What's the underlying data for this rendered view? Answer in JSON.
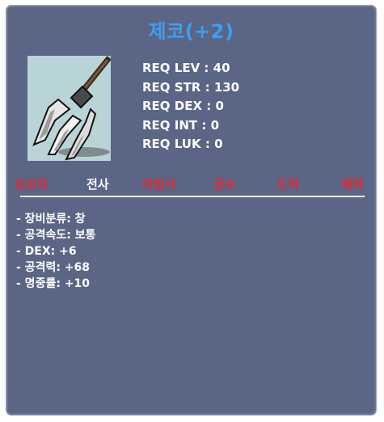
{
  "item": {
    "name": "제코(+2)",
    "icon": "spear-trident-icon",
    "title_color": "#3f9ef2"
  },
  "requirements": [
    {
      "label": "REQ LEV",
      "value": "40"
    },
    {
      "label": "REQ STR",
      "value": "130"
    },
    {
      "label": "REQ DEX",
      "value": "0"
    },
    {
      "label": "REQ INT",
      "value": "0"
    },
    {
      "label": "REQ LUK",
      "value": "0"
    }
  ],
  "jobs": [
    {
      "name": "초보자",
      "color": "#e8282f"
    },
    {
      "name": "전사",
      "color": "#ffffff"
    },
    {
      "name": "마법사",
      "color": "#e8282f"
    },
    {
      "name": "궁수",
      "color": "#e8282f"
    },
    {
      "name": "도적",
      "color": "#e8282f"
    },
    {
      "name": "해적",
      "color": "#e8282f"
    }
  ],
  "stats": [
    "- 장비분류: 창",
    "- 공격속도: 보통",
    "- DEX: +6",
    "- 공격력: +68",
    "- 명중률: +10"
  ]
}
